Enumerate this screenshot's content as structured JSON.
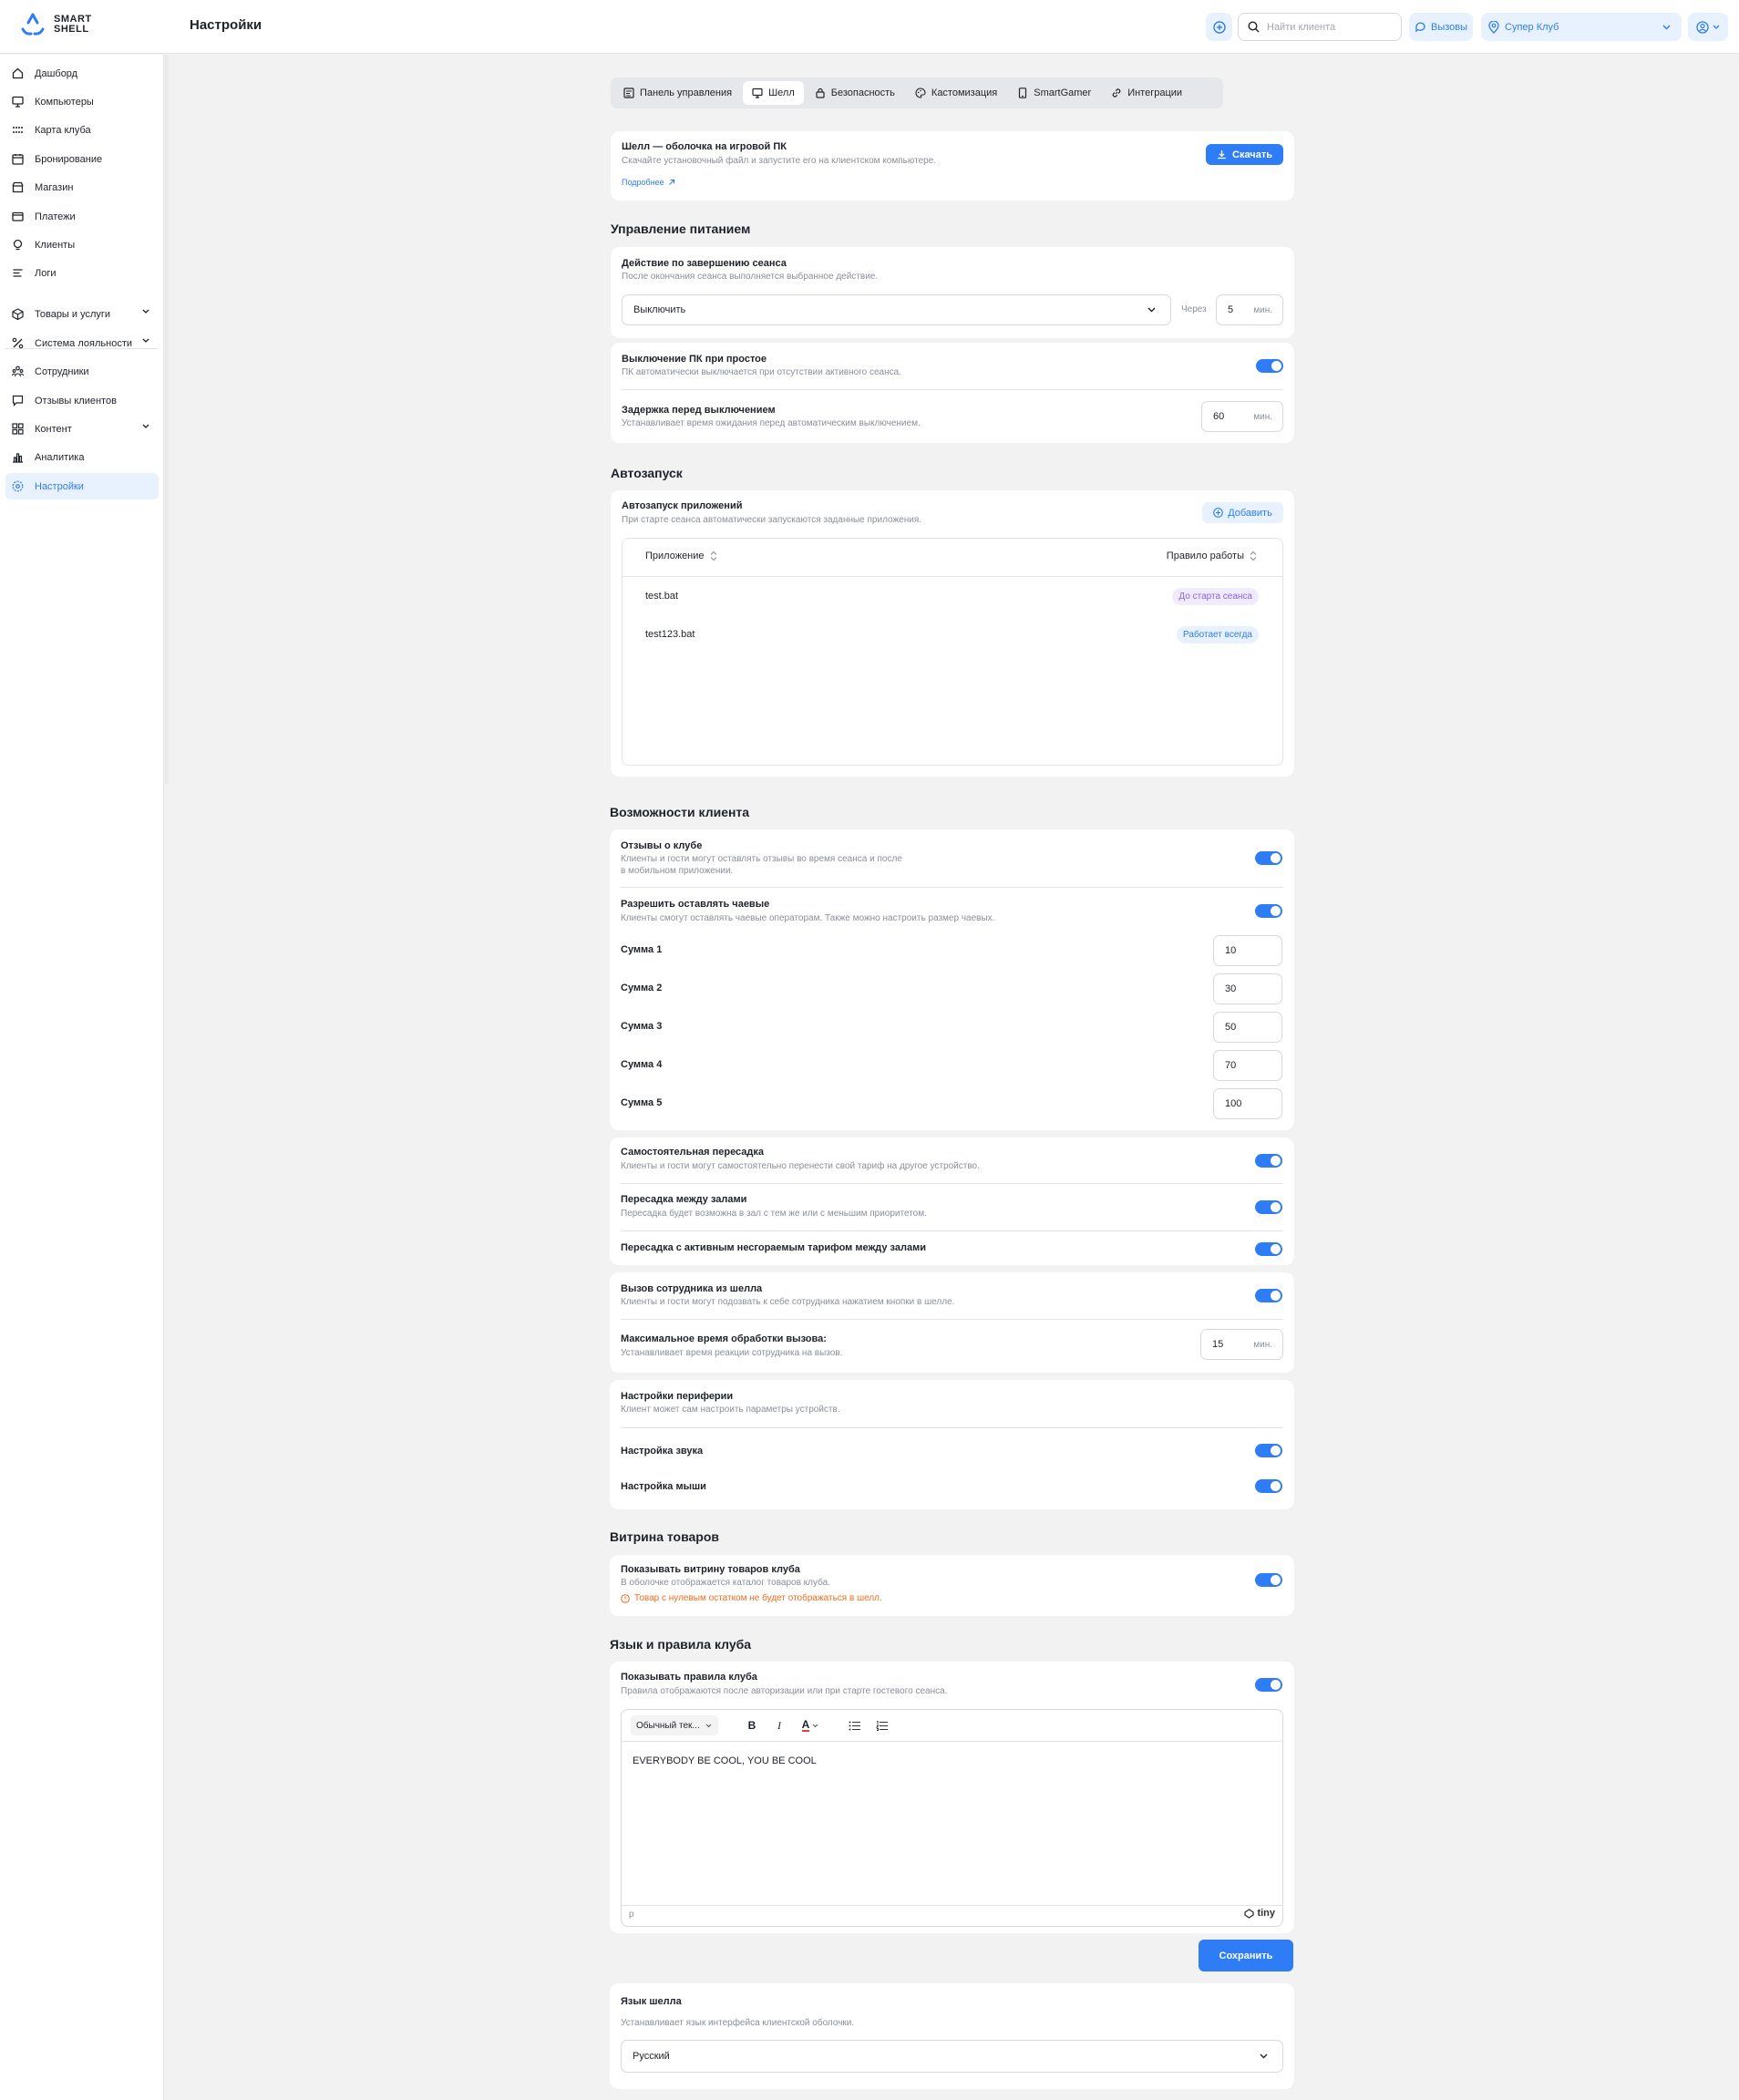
{
  "header": {
    "logo_line1": "SMART",
    "logo_line2": "SHELL",
    "page_title": "Настройки",
    "search_placeholder": "Найти клиента",
    "calls_label": "Вызовы",
    "club_label": "Супер Клуб"
  },
  "sidebar": {
    "items": [
      {
        "label": "Дашборд",
        "icon": "home-icon"
      },
      {
        "label": "Компьютеры",
        "icon": "monitor-icon"
      },
      {
        "label": "Карта клуба",
        "icon": "grid-dots-icon"
      },
      {
        "label": "Бронирование",
        "icon": "calendar-icon"
      },
      {
        "label": "Магазин",
        "icon": "store-icon"
      },
      {
        "label": "Платежи",
        "icon": "wallet-icon"
      },
      {
        "label": "Клиенты",
        "icon": "user-icon"
      },
      {
        "label": "Логи",
        "icon": "list-icon"
      }
    ],
    "items2": [
      {
        "label": "Товары и услуги",
        "icon": "box-icon",
        "expandable": true
      },
      {
        "label": "Система лояльности",
        "icon": "percent-icon",
        "expandable": true
      },
      {
        "label": "Сотрудники",
        "icon": "team-icon",
        "expandable": false
      },
      {
        "label": "Отзывы клиентов",
        "icon": "message-icon",
        "expandable": false
      },
      {
        "label": "Контент",
        "icon": "layout-icon",
        "expandable": true
      },
      {
        "label": "Аналитика",
        "icon": "bar-chart-icon",
        "expandable": false
      },
      {
        "label": "Настройки",
        "icon": "gear-icon",
        "expandable": false,
        "active": true
      }
    ]
  },
  "tabs": [
    {
      "label": "Панель управления",
      "icon": "panel-icon"
    },
    {
      "label": "Шелл",
      "icon": "shell-icon",
      "active": true
    },
    {
      "label": "Безопасность",
      "icon": "lock-icon"
    },
    {
      "label": "Кастомизация",
      "icon": "palette-icon"
    },
    {
      "label": "SmartGamer",
      "icon": "phone-icon"
    },
    {
      "label": "Интеграции",
      "icon": "link-icon"
    }
  ],
  "download_card": {
    "title": "Шелл — оболочка на игровой ПК",
    "subtitle": "Скачайте установочный файл и запустите его на клиентском компьютере.",
    "more_link": "Подробнее",
    "download_button": "Скачать"
  },
  "power": {
    "section_title": "Управление питанием",
    "session_end_title": "Действие по завершению сеанса",
    "session_end_sub": "После окончания сеанса выполняется выбранное действие.",
    "action_value": "Выключить",
    "after_label": "Через",
    "after_value": "5",
    "unit_min": "мин.",
    "idle_title": "Выключение ПК при простое",
    "idle_sub": "ПК автоматически выключается при отсутствии активного сеанса.",
    "idle_enabled": true,
    "delay_title": "Задержка перед выключением",
    "delay_sub": "Устанавливает время ожидания перед автоматическим выключением.",
    "delay_value": "60"
  },
  "autostart": {
    "section_title": "Автозапуск",
    "title": "Автозапуск приложений",
    "subtitle": "При старте сеанса автоматически запускаются заданные приложения.",
    "add_button": "Добавить",
    "col_app": "Приложение",
    "col_rule": "Правило работы",
    "rows": [
      {
        "app": "test.bat",
        "rule": "До старта сеанса",
        "rule_color": "purple"
      },
      {
        "app": "test123.bat",
        "rule": "Работает всегда",
        "rule_color": "blue"
      }
    ]
  },
  "client": {
    "section_title": "Возможности клиента",
    "reviews_title": "Отзывы о клубе",
    "reviews_sub1": "Клиенты и гости могут оставлять отзывы во время сеанса и после",
    "reviews_sub2": "в мобильном приложении.",
    "tips_title": "Разрешить оставлять чаевые",
    "tips_sub": "Клиенты смогут оставлять чаевые операторам. Также можно настроить размер чаевых.",
    "amounts": [
      {
        "label": "Сумма 1",
        "value": "10"
      },
      {
        "label": "Сумма 2",
        "value": "30"
      },
      {
        "label": "Сумма 3",
        "value": "50"
      },
      {
        "label": "Сумма 4",
        "value": "70"
      },
      {
        "label": "Сумма 5",
        "value": "100"
      }
    ],
    "transfer_title": "Самостоятельная пересадка",
    "transfer_sub": "Клиенты и гости могут самостоятельно перенести свой тариф на другое устройство.",
    "halls_title": "Пересадка между залами",
    "halls_sub": "Пересадка будет возможна в зал с тем же или с меньшим приоритетом.",
    "nonburn_title": "Пересадка с активным несгораемым тарифом между залами",
    "call_title": "Вызов сотрудника из шелла",
    "call_sub": "Клиенты и гости могут подозвать к себе сотрудника нажатием кнопки в шелле.",
    "maxcall_title": "Максимальное время обработки вызова:",
    "maxcall_sub": "Устанавливает время реакции сотрудника на вызов.",
    "maxcall_value": "15",
    "unit_min": "мин.",
    "periph_title": "Настройки периферии",
    "periph_sub": "Клиент может сам настроить параметры устройств.",
    "sound_title": "Настройка звука",
    "mouse_title": "Настройка мыши"
  },
  "showcase": {
    "section_title": "Витрина товаров",
    "title": "Показывать витрину товаров клуба",
    "subtitle": "В оболочке отображается каталог товаров клуба.",
    "warning": "Товар с нулевым остатком не будет отображаться в шелл."
  },
  "rules": {
    "section_title": "Язык и правила клуба",
    "title": "Показывать правила клуба",
    "subtitle": "Правила отображаются после авторизации или при старте гостевого сеанса.",
    "format_select": "Обычный тек...",
    "content": "EVERYBODY BE COOL, YOU BE COOL",
    "status_path": "p",
    "brand": "tiny",
    "save_button": "Сохранить"
  },
  "language": {
    "title": "Язык шелла",
    "subtitle": "Устанавливает язык интерфейса клиентской оболочки.",
    "value": "Русский"
  },
  "colors": {
    "accent": "#2f7df6",
    "accent_light": "#e8f1fe",
    "warning": "#f06d1f",
    "purple": "#8b5cf6"
  }
}
